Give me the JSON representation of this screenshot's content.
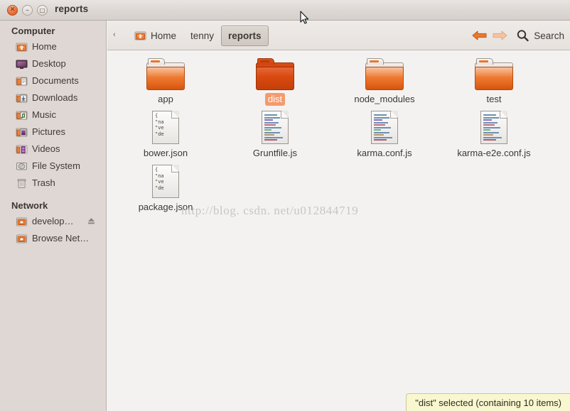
{
  "window": {
    "title": "reports",
    "controls": [
      {
        "name": "close",
        "glyph": "✕"
      },
      {
        "name": "minimize",
        "glyph": "–"
      },
      {
        "name": "maximize",
        "glyph": "□"
      }
    ]
  },
  "sidebar": {
    "sections": [
      {
        "heading": "Computer",
        "items": [
          {
            "label": "Home",
            "icon": "home-folder-icon"
          },
          {
            "label": "Desktop",
            "icon": "desktop-icon"
          },
          {
            "label": "Documents",
            "icon": "documents-folder-icon"
          },
          {
            "label": "Downloads",
            "icon": "downloads-folder-icon"
          },
          {
            "label": "Music",
            "icon": "music-folder-icon"
          },
          {
            "label": "Pictures",
            "icon": "pictures-folder-icon"
          },
          {
            "label": "Videos",
            "icon": "videos-folder-icon"
          },
          {
            "label": "File System",
            "icon": "drive-icon"
          },
          {
            "label": "Trash",
            "icon": "trash-icon"
          }
        ]
      },
      {
        "heading": "Network",
        "items": [
          {
            "label": "develop…",
            "icon": "network-share-icon",
            "eject": true
          },
          {
            "label": "Browse Net…",
            "icon": "network-share-icon",
            "eject": false
          }
        ]
      }
    ]
  },
  "pathbar": {
    "overflow_marker": "‹",
    "crumbs": [
      {
        "label": "Home",
        "icon": "home-folder-icon",
        "current": false
      },
      {
        "label": "tenny",
        "icon": "",
        "current": false
      },
      {
        "label": "reports",
        "icon": "",
        "current": true
      }
    ],
    "back_label": "Back",
    "forward_label": "Forward",
    "search_label": "Search"
  },
  "files": [
    {
      "name": "app",
      "type": "folder",
      "selected": false
    },
    {
      "name": "dist",
      "type": "folder",
      "selected": true
    },
    {
      "name": "node_modules",
      "type": "folder",
      "selected": false
    },
    {
      "name": "test",
      "type": "folder",
      "selected": false
    },
    {
      "name": "bower.json",
      "type": "json",
      "selected": false
    },
    {
      "name": "Gruntfile.js",
      "type": "script",
      "selected": false
    },
    {
      "name": "karma.conf.js",
      "type": "script",
      "selected": false
    },
    {
      "name": "karma-e2e.conf.js",
      "type": "script",
      "selected": false
    },
    {
      "name": "package.json",
      "type": "json",
      "selected": false
    }
  ],
  "json_preview": [
    "{",
    "  \"na",
    "  \"ve",
    "  \"de"
  ],
  "statusbar": {
    "text": "\"dist\" selected (containing 10 items)"
  },
  "watermark": {
    "text": "http://blog. csdn. net/u012844719"
  },
  "colors": {
    "titlebar_top": "#e8e4e1",
    "titlebar_bottom": "#d6d0cb",
    "sidebar_bg": "#ded7d3",
    "content_bg": "#f4f2f1",
    "selection_orange": "#f49a6e",
    "folder_orange": "#ef7f37",
    "folder_selected_orange": "#d9490f",
    "status_yellow": "#f8f7cf",
    "close_button": "#e8743c"
  }
}
